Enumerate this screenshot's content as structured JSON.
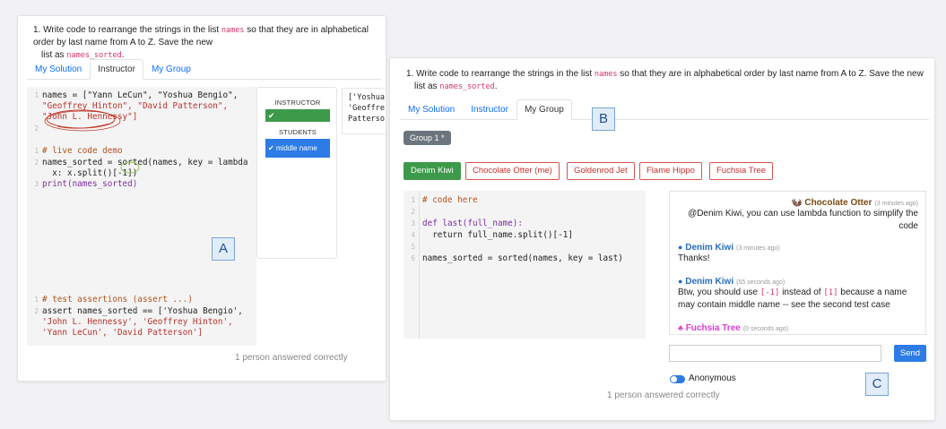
{
  "question": {
    "prefix": "1. Write code to rearrange the strings in the list ",
    "code_names": "names",
    "middle": " so that they are in alphabetical order by last name from A to Z. Save the new list as ",
    "code_sorted": "names_sorted",
    "suffix": ".",
    "left_line1": "1. Write code to rearrange the strings in the list ",
    "left_line1_tail": " so that they are in alphabetical order by last name from A to Z. Save the new",
    "left_line2": "list as ",
    "right_line1_tail": " so that they are in alphabetical order by last name from A to Z. Save the new",
    "right_line2": "list as "
  },
  "tabs": [
    "My Solution",
    "Instructor",
    "My Group"
  ],
  "panelA": {
    "code": [
      "names = [\"Yann LeCun\", \"Yoshua Bengio\",",
      "\"Geoffrey Hinton\", \"David Patterson\",",
      "\"John L. Hennessy\"]",
      "",
      "# live code demo",
      "names_sorted = sorted(names, key = lambda",
      "  x: x.split()[-1])",
      "print(names_sorted)",
      "# test assertions (assert ...)",
      "assert names_sorted == ['Yoshua Bengio',",
      "'John L. Hennessy', 'Geoffrey Hinton',",
      "'Yann LeCun', 'David Patterson']"
    ],
    "line_numbers": [
      "1",
      "2",
      "1",
      "2",
      "3",
      "1",
      "2"
    ],
    "vote": {
      "instructor_label": "INSTRUCTOR",
      "instructor_mark": "✔",
      "instructor_level": 1.0,
      "students_label": "STUDENTS",
      "student_answer": "✔ middle name",
      "student_level": 1.0
    },
    "output": "['Yoshua\n'Geoffre\nPatterso",
    "answered": "1 person answered correctly",
    "label": "A"
  },
  "panelB": {
    "label": "B",
    "group_button": "Group 1 *",
    "members": [
      "Denim Kiwi",
      "Chocolate Otter (me)",
      "Goldenrod Jet",
      "Flame Hippo",
      "Fuchsia Tree"
    ],
    "code": [
      "# code here",
      "",
      "def last(full_name):",
      "  return full_name.split()[-1]",
      "",
      "names_sorted = sorted(names, key = last)"
    ],
    "line_numbers": [
      "1",
      "2",
      "3",
      "4",
      "5",
      "6"
    ],
    "answered": "1 person answered correctly"
  },
  "chat": {
    "messages": [
      {
        "author": "Chocolate Otter",
        "time": "(3 minutes ago)",
        "text": "@Denim Kiwi, you can use lambda function to simplify the code",
        "color": "#7a4a12"
      },
      {
        "author": "Denim Kiwi",
        "time": "(3 minutes ago)",
        "text": "Thanks!",
        "color": "#2a6db8"
      },
      {
        "author": "Denim Kiwi",
        "time": "(55 seconds ago)",
        "text_a": "Btw, you should use ",
        "code_a": "[-1]",
        "text_b": " instead of ",
        "code_b": "[1]",
        "text_c": " because a name may contain middle name -- see the second test case",
        "color": "#2a6db8"
      },
      {
        "author": "Fuchsia Tree",
        "time": "(0 seconds ago)",
        "color": "#d63fcf"
      }
    ],
    "send_label": "Send",
    "anonymous_label": "Anonymous",
    "label": "C"
  },
  "colors": {
    "accent": "#2d7be5",
    "vote_green": "#3c9a4a",
    "chip_red": "#d9534f"
  }
}
